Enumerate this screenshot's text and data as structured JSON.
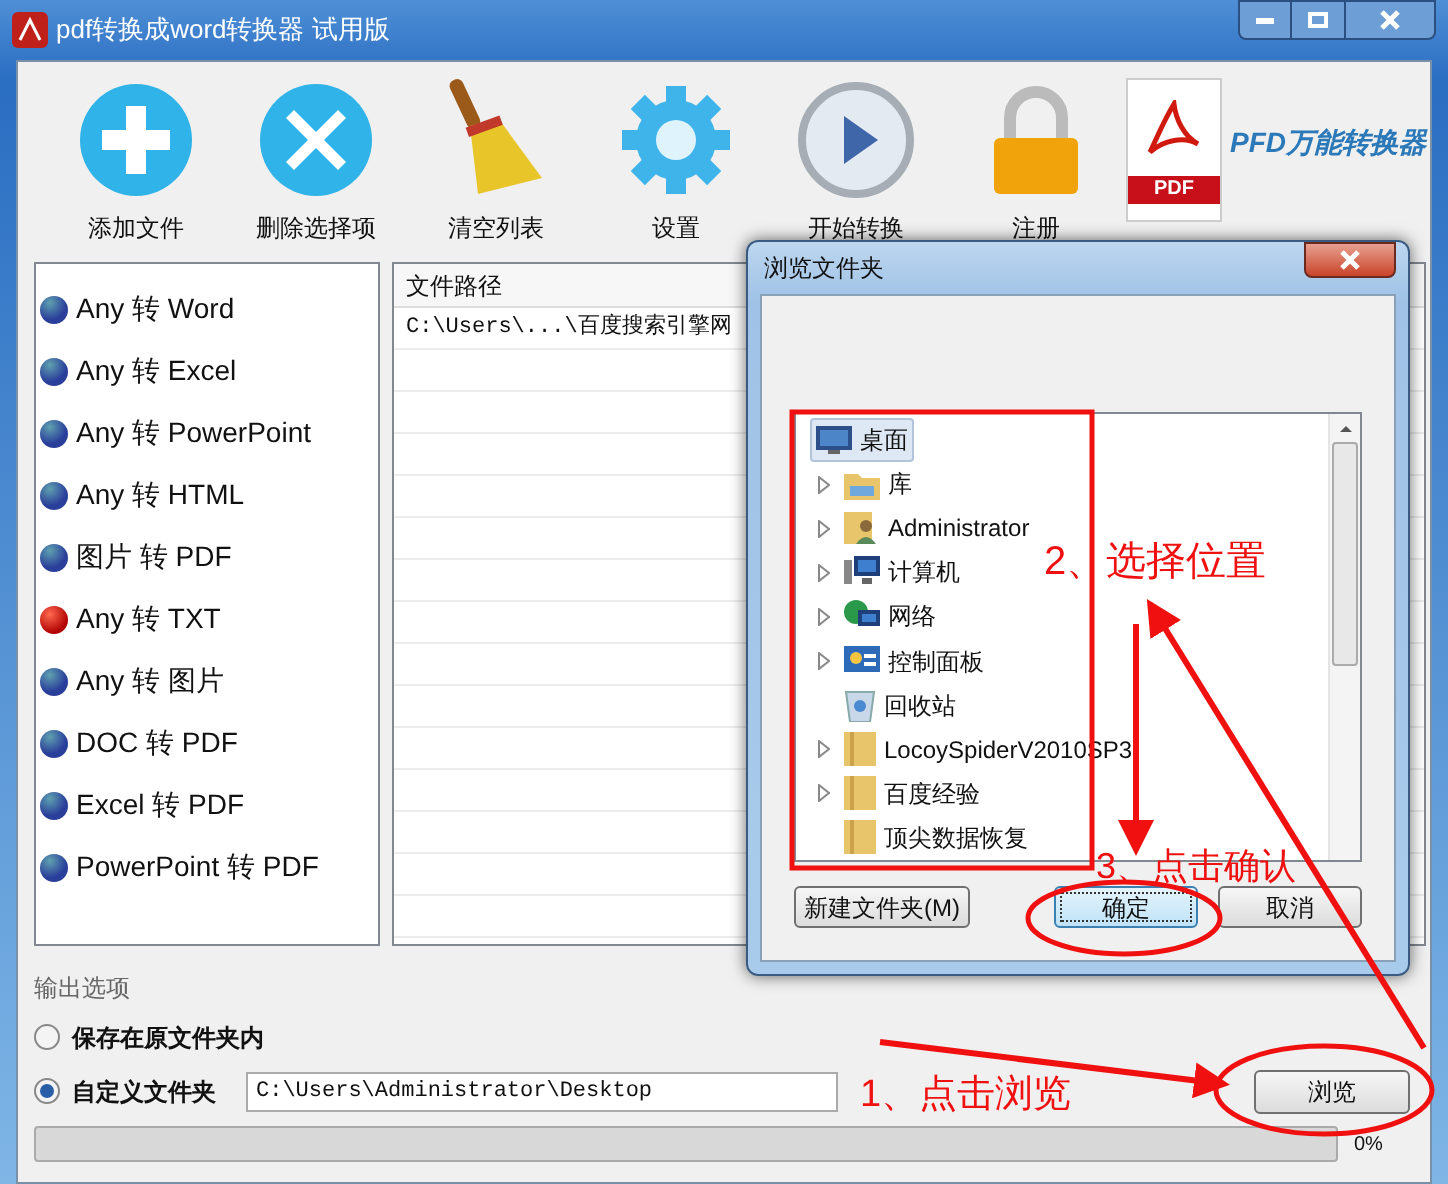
{
  "window": {
    "title": "pdf转换成word转换器 试用版"
  },
  "toolbar": [
    {
      "label": "添加文件",
      "kind": "add"
    },
    {
      "label": "删除选择项",
      "kind": "delete"
    },
    {
      "label": "清空列表",
      "kind": "broom"
    },
    {
      "label": "设置",
      "kind": "gear"
    },
    {
      "label": "开始转换",
      "kind": "play"
    },
    {
      "label": "注册",
      "kind": "lock"
    }
  ],
  "logo": {
    "badge": "PDF",
    "text": "PFD万能转换器"
  },
  "formats": [
    {
      "label": "Any 转 Word",
      "selected": false
    },
    {
      "label": "Any 转 Excel",
      "selected": false
    },
    {
      "label": "Any 转 PowerPoint",
      "selected": false
    },
    {
      "label": "Any 转 HTML",
      "selected": false
    },
    {
      "label": "图片 转 PDF",
      "selected": false
    },
    {
      "label": "Any 转 TXT",
      "selected": true
    },
    {
      "label": "Any 转 图片",
      "selected": false
    },
    {
      "label": "DOC 转 PDF",
      "selected": false
    },
    {
      "label": "Excel 转 PDF",
      "selected": false
    },
    {
      "label": "PowerPoint 转 PDF",
      "selected": false
    }
  ],
  "file_table": {
    "columns": [
      "文件路径"
    ],
    "rows": [
      [
        "C:\\Users\\...\\百度搜索引擎网"
      ]
    ]
  },
  "output": {
    "title": "输出选项",
    "options": [
      {
        "label": "保存在原文件夹内",
        "selected": false
      },
      {
        "label": "自定义文件夹",
        "selected": true
      }
    ],
    "path": "C:\\Users\\Administrator\\Desktop",
    "browse_button": "浏览",
    "progress": {
      "level": 0,
      "reading": "0%"
    }
  },
  "dialog": {
    "title": "浏览文件夹",
    "tree": [
      {
        "label": "桌面",
        "kind": "desktop",
        "selected": true,
        "children": [
          {
            "label": "库",
            "kind": "library",
            "expandable": true,
            "selected": false
          },
          {
            "label": "Administrator",
            "kind": "user",
            "expandable": true,
            "selected": false
          },
          {
            "label": "计算机",
            "kind": "computer",
            "expandable": true,
            "selected": false
          },
          {
            "label": "网络",
            "kind": "network",
            "expandable": true,
            "selected": false
          },
          {
            "label": "控制面板",
            "kind": "control-panel",
            "expandable": true,
            "selected": false
          },
          {
            "label": "回收站",
            "kind": "recycle-bin",
            "expandable": false,
            "selected": false
          },
          {
            "label": "LocoySpiderV2010SP3",
            "kind": "folder",
            "expandable": true,
            "selected": false
          },
          {
            "label": "百度经验",
            "kind": "folder",
            "expandable": true,
            "selected": false
          },
          {
            "label": "顶尖数据恢复",
            "kind": "folder",
            "expandable": false,
            "selected": false
          }
        ]
      }
    ],
    "buttons": [
      {
        "label": "新建文件夹(M)",
        "focused": false
      },
      {
        "label": "确定",
        "focused": true
      },
      {
        "label": "取消",
        "focused": false
      }
    ]
  },
  "annotations": [
    {
      "text": "2、选择位置"
    },
    {
      "text": "3、点击确认"
    },
    {
      "text": "1、点击浏览"
    }
  ]
}
